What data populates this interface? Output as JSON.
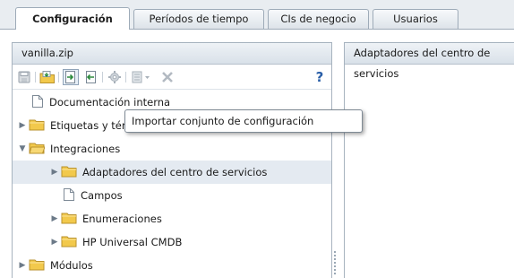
{
  "tabs": [
    {
      "label": "Configuración",
      "active": true
    },
    {
      "label": "Períodos de tiempo",
      "active": false
    },
    {
      "label": "CIs de negocio",
      "active": false
    },
    {
      "label": "Usuarios",
      "active": false
    }
  ],
  "left_panel": {
    "title": "vanilla.zip",
    "toolbar": {
      "icons": [
        "save-icon",
        "open-folder-icon",
        "import-icon",
        "export-icon",
        "gear-icon",
        "list-dropdown-icon",
        "delete-icon",
        "help-icon"
      ],
      "help_label": "?"
    },
    "tree": [
      {
        "label": "Documentación interna",
        "type": "document",
        "level": 0,
        "expandable": false
      },
      {
        "label": "Etiquetas y términos",
        "type": "folder",
        "level": 0,
        "expandable": true,
        "expanded": false
      },
      {
        "label": "Integraciones",
        "type": "folder",
        "level": 0,
        "expandable": true,
        "expanded": true
      },
      {
        "label": "Adaptadores del centro de servicios",
        "type": "folder",
        "level": 1,
        "expandable": true,
        "expanded": false,
        "selected": true
      },
      {
        "label": "Campos",
        "type": "document",
        "level": 1,
        "expandable": false
      },
      {
        "label": "Enumeraciones",
        "type": "folder",
        "level": 1,
        "expandable": true,
        "expanded": false
      },
      {
        "label": "HP Universal CMDB",
        "type": "folder",
        "level": 1,
        "expandable": true,
        "expanded": false
      },
      {
        "label": "Módulos",
        "type": "folder",
        "level": 0,
        "expandable": true,
        "expanded": false
      }
    ]
  },
  "right_panel": {
    "title": "Adaptadores del centro de servicios"
  },
  "tooltip": {
    "text": "Importar conjunto de configuración"
  },
  "colors": {
    "panel_border": "#a7b3bf",
    "selected_row": "#e4eaf1",
    "folder_yellow": "#f2c94c",
    "help_blue": "#2a5fa8"
  }
}
